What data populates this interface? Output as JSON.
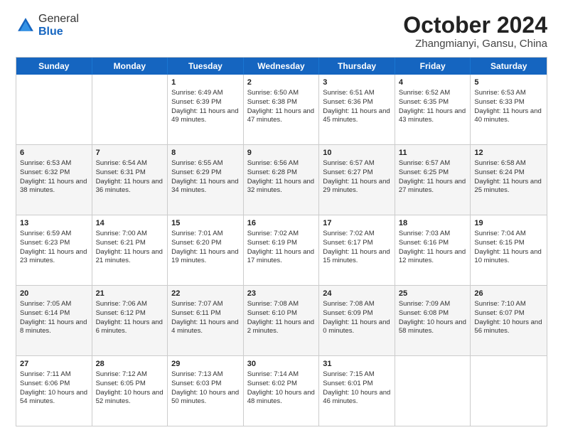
{
  "logo": {
    "general": "General",
    "blue": "Blue"
  },
  "title": "October 2024",
  "subtitle": "Zhangmianyi, Gansu, China",
  "headers": [
    "Sunday",
    "Monday",
    "Tuesday",
    "Wednesday",
    "Thursday",
    "Friday",
    "Saturday"
  ],
  "rows": [
    {
      "alt": false,
      "cells": [
        {
          "day": "",
          "content": ""
        },
        {
          "day": "",
          "content": ""
        },
        {
          "day": "1",
          "content": "Sunrise: 6:49 AM\nSunset: 6:39 PM\nDaylight: 11 hours and 49 minutes."
        },
        {
          "day": "2",
          "content": "Sunrise: 6:50 AM\nSunset: 6:38 PM\nDaylight: 11 hours and 47 minutes."
        },
        {
          "day": "3",
          "content": "Sunrise: 6:51 AM\nSunset: 6:36 PM\nDaylight: 11 hours and 45 minutes."
        },
        {
          "day": "4",
          "content": "Sunrise: 6:52 AM\nSunset: 6:35 PM\nDaylight: 11 hours and 43 minutes."
        },
        {
          "day": "5",
          "content": "Sunrise: 6:53 AM\nSunset: 6:33 PM\nDaylight: 11 hours and 40 minutes."
        }
      ]
    },
    {
      "alt": true,
      "cells": [
        {
          "day": "6",
          "content": "Sunrise: 6:53 AM\nSunset: 6:32 PM\nDaylight: 11 hours and 38 minutes."
        },
        {
          "day": "7",
          "content": "Sunrise: 6:54 AM\nSunset: 6:31 PM\nDaylight: 11 hours and 36 minutes."
        },
        {
          "day": "8",
          "content": "Sunrise: 6:55 AM\nSunset: 6:29 PM\nDaylight: 11 hours and 34 minutes."
        },
        {
          "day": "9",
          "content": "Sunrise: 6:56 AM\nSunset: 6:28 PM\nDaylight: 11 hours and 32 minutes."
        },
        {
          "day": "10",
          "content": "Sunrise: 6:57 AM\nSunset: 6:27 PM\nDaylight: 11 hours and 29 minutes."
        },
        {
          "day": "11",
          "content": "Sunrise: 6:57 AM\nSunset: 6:25 PM\nDaylight: 11 hours and 27 minutes."
        },
        {
          "day": "12",
          "content": "Sunrise: 6:58 AM\nSunset: 6:24 PM\nDaylight: 11 hours and 25 minutes."
        }
      ]
    },
    {
      "alt": false,
      "cells": [
        {
          "day": "13",
          "content": "Sunrise: 6:59 AM\nSunset: 6:23 PM\nDaylight: 11 hours and 23 minutes."
        },
        {
          "day": "14",
          "content": "Sunrise: 7:00 AM\nSunset: 6:21 PM\nDaylight: 11 hours and 21 minutes."
        },
        {
          "day": "15",
          "content": "Sunrise: 7:01 AM\nSunset: 6:20 PM\nDaylight: 11 hours and 19 minutes."
        },
        {
          "day": "16",
          "content": "Sunrise: 7:02 AM\nSunset: 6:19 PM\nDaylight: 11 hours and 17 minutes."
        },
        {
          "day": "17",
          "content": "Sunrise: 7:02 AM\nSunset: 6:17 PM\nDaylight: 11 hours and 15 minutes."
        },
        {
          "day": "18",
          "content": "Sunrise: 7:03 AM\nSunset: 6:16 PM\nDaylight: 11 hours and 12 minutes."
        },
        {
          "day": "19",
          "content": "Sunrise: 7:04 AM\nSunset: 6:15 PM\nDaylight: 11 hours and 10 minutes."
        }
      ]
    },
    {
      "alt": true,
      "cells": [
        {
          "day": "20",
          "content": "Sunrise: 7:05 AM\nSunset: 6:14 PM\nDaylight: 11 hours and 8 minutes."
        },
        {
          "day": "21",
          "content": "Sunrise: 7:06 AM\nSunset: 6:12 PM\nDaylight: 11 hours and 6 minutes."
        },
        {
          "day": "22",
          "content": "Sunrise: 7:07 AM\nSunset: 6:11 PM\nDaylight: 11 hours and 4 minutes."
        },
        {
          "day": "23",
          "content": "Sunrise: 7:08 AM\nSunset: 6:10 PM\nDaylight: 11 hours and 2 minutes."
        },
        {
          "day": "24",
          "content": "Sunrise: 7:08 AM\nSunset: 6:09 PM\nDaylight: 11 hours and 0 minutes."
        },
        {
          "day": "25",
          "content": "Sunrise: 7:09 AM\nSunset: 6:08 PM\nDaylight: 10 hours and 58 minutes."
        },
        {
          "day": "26",
          "content": "Sunrise: 7:10 AM\nSunset: 6:07 PM\nDaylight: 10 hours and 56 minutes."
        }
      ]
    },
    {
      "alt": false,
      "cells": [
        {
          "day": "27",
          "content": "Sunrise: 7:11 AM\nSunset: 6:06 PM\nDaylight: 10 hours and 54 minutes."
        },
        {
          "day": "28",
          "content": "Sunrise: 7:12 AM\nSunset: 6:05 PM\nDaylight: 10 hours and 52 minutes."
        },
        {
          "day": "29",
          "content": "Sunrise: 7:13 AM\nSunset: 6:03 PM\nDaylight: 10 hours and 50 minutes."
        },
        {
          "day": "30",
          "content": "Sunrise: 7:14 AM\nSunset: 6:02 PM\nDaylight: 10 hours and 48 minutes."
        },
        {
          "day": "31",
          "content": "Sunrise: 7:15 AM\nSunset: 6:01 PM\nDaylight: 10 hours and 46 minutes."
        },
        {
          "day": "",
          "content": ""
        },
        {
          "day": "",
          "content": ""
        }
      ]
    }
  ]
}
